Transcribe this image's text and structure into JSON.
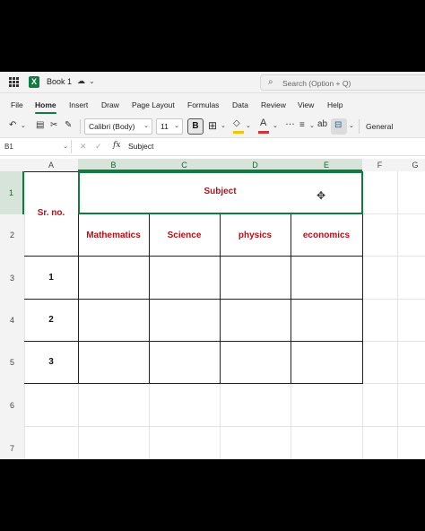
{
  "titlebar": {
    "book_title": "Book 1",
    "search_placeholder": "Search (Option + Q)"
  },
  "menu": [
    "File",
    "Home",
    "Insert",
    "Draw",
    "Page Layout",
    "Formulas",
    "Data",
    "Review",
    "View",
    "Help"
  ],
  "menu_active": "Home",
  "ribbon": {
    "font_name": "Calibri (Body)",
    "font_size": "11",
    "bold_label": "B",
    "number_format": "General",
    "fill_color": "#f5c400",
    "font_color": "#d13438"
  },
  "formula_bar": {
    "name_box": "B1",
    "fx": "fx",
    "value": "Subject"
  },
  "columns": [
    "A",
    "B",
    "C",
    "D",
    "E",
    "F",
    "G"
  ],
  "rows": [
    "1",
    "2",
    "3",
    "4",
    "5",
    "6",
    "7"
  ],
  "cells": {
    "sr_no": "Sr. no.",
    "subject": "Subject",
    "headers": [
      "Mathematics",
      "Science",
      "physics",
      "economics"
    ],
    "serials": [
      "1",
      "2",
      "3"
    ]
  },
  "colors": {
    "accent": "#107c41",
    "header_text": "#b4111a"
  }
}
